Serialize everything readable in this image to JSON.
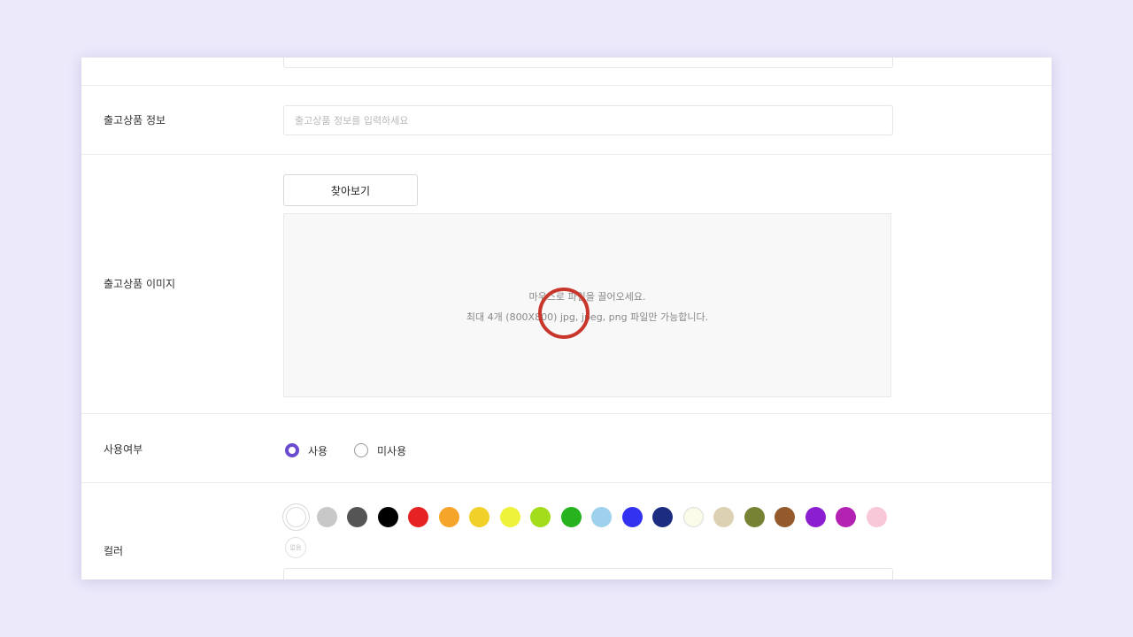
{
  "form": {
    "info": {
      "label": "출고상품 정보",
      "placeholder": "출고상품 정보를 입력하세요"
    },
    "image": {
      "label": "출고상품 이미지",
      "browse_label": "찾아보기",
      "drop_line1": "마우스로 파일을 끌어오세요.",
      "drop_line2": "최대 4개 (800X800) jpg, jpeg, png  파일만 가능합니다."
    },
    "usage": {
      "label": "사용여부",
      "options": [
        {
          "label": "사용",
          "checked": true
        },
        {
          "label": "미사용",
          "checked": false
        }
      ]
    },
    "color": {
      "label": "컬러",
      "swatches": [
        {
          "name": "white",
          "hex": "#ffffff"
        },
        {
          "name": "light-gray",
          "hex": "#c8c8c8"
        },
        {
          "name": "dark-gray",
          "hex": "#555555"
        },
        {
          "name": "black",
          "hex": "#000000"
        },
        {
          "name": "red",
          "hex": "#e62222"
        },
        {
          "name": "orange",
          "hex": "#f5a52a"
        },
        {
          "name": "gold",
          "hex": "#f2d02a"
        },
        {
          "name": "yellow",
          "hex": "#eef23a"
        },
        {
          "name": "lime",
          "hex": "#a2dc1a"
        },
        {
          "name": "green",
          "hex": "#26b31e"
        },
        {
          "name": "sky-blue",
          "hex": "#9ed1ec"
        },
        {
          "name": "blue",
          "hex": "#3232f0"
        },
        {
          "name": "navy",
          "hex": "#1c2c80"
        },
        {
          "name": "ivory",
          "hex": "#fbfbe9"
        },
        {
          "name": "beige",
          "hex": "#dcd1b2"
        },
        {
          "name": "olive",
          "hex": "#788234"
        },
        {
          "name": "brown",
          "hex": "#945a2c"
        },
        {
          "name": "purple",
          "hex": "#8c1ed2"
        },
        {
          "name": "magenta",
          "hex": "#b422b4"
        },
        {
          "name": "pink",
          "hex": "#f8c8d8"
        }
      ],
      "mini_chip_label": "없음"
    }
  },
  "colors": {
    "accent": "#6a4ad0",
    "background": "#ece9fb",
    "cursor_ring": "#c8362c"
  }
}
